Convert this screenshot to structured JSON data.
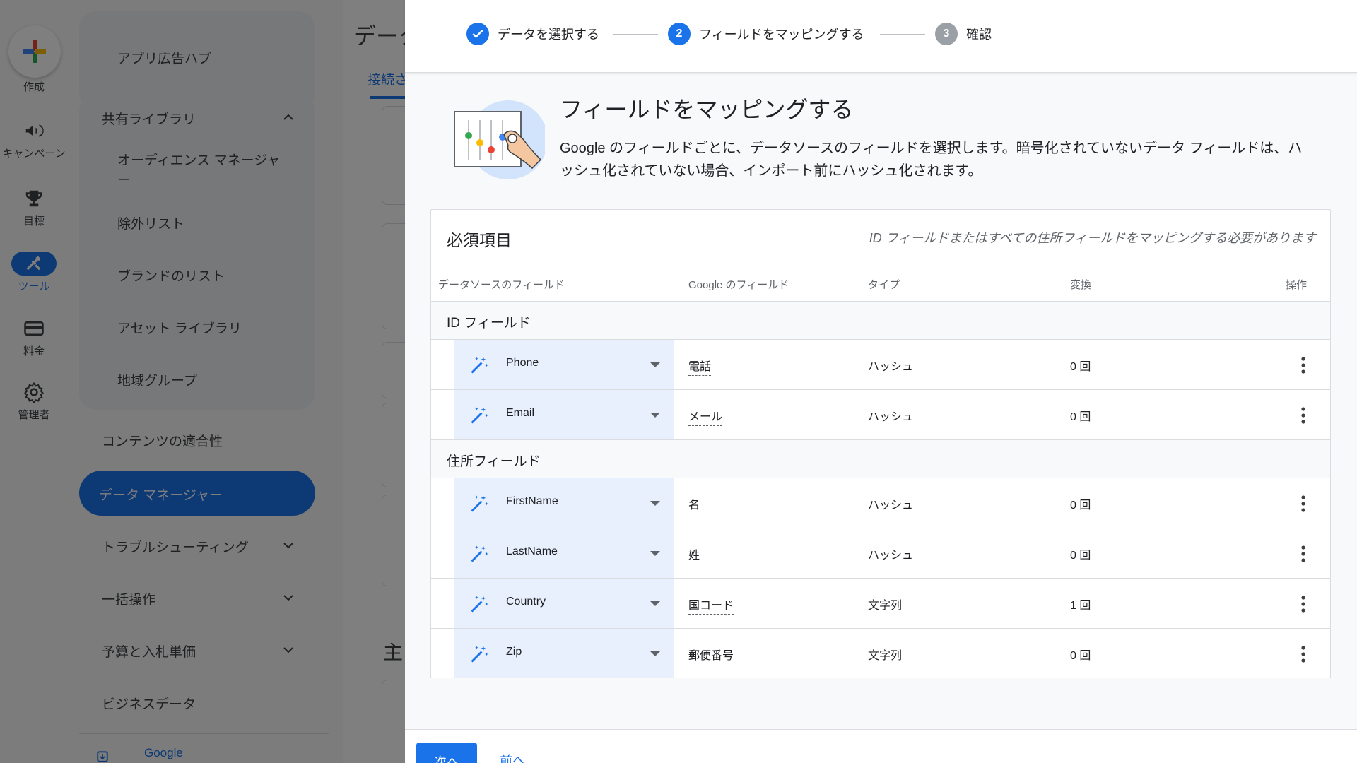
{
  "rail": {
    "items": [
      {
        "label": "作成"
      },
      {
        "label": "キャンペーン"
      },
      {
        "label": "目標"
      },
      {
        "label": "ツール"
      },
      {
        "label": "料金"
      },
      {
        "label": "管理者"
      }
    ]
  },
  "subnav": {
    "app_ads_hub": "アプリ広告ハブ",
    "shared_library": "共有ライブラリ",
    "shared_items": [
      "オーディエンス マネージャー",
      "除外リスト",
      "ブランドのリスト",
      "アセット ライブラリ",
      "地域グループ"
    ],
    "content_suitability": "コンテンツの適合性",
    "data_manager": "データ マネージャー",
    "troubleshooting": "トラブルシューティング",
    "bulk_actions": "一括操作",
    "budgets_bids": "予算と入札単価",
    "business_data": "ビジネスデータ",
    "google_link": "Google"
  },
  "background": {
    "title": "データ",
    "tab": "接続さ",
    "subheading": "主"
  },
  "stepper": {
    "steps": [
      {
        "number": "",
        "label": "データを選択する",
        "state": "done"
      },
      {
        "number": "2",
        "label": "フィールドをマッピングする",
        "state": "current"
      },
      {
        "number": "3",
        "label": "確認",
        "state": "upcoming"
      }
    ]
  },
  "hero": {
    "title": "フィールドをマッピングする",
    "description": "Google のフィールドごとに、データソースのフィールドを選択します。暗号化されていないデータ フィールドは、ハッシュ化されていない場合、インポート前にハッシュ化されます。"
  },
  "card": {
    "title": "必須項目",
    "note": "ID フィールドまたはすべての住所フィールドをマッピングする必要があります",
    "headers": {
      "source": "データソースのフィールド",
      "google": "Google のフィールド",
      "type": "タイプ",
      "transform": "変換",
      "actions": "操作"
    },
    "sections": [
      {
        "title": "ID フィールド",
        "rows": [
          {
            "source": "Phone",
            "google": "電話",
            "type": "ハッシュ",
            "transform": "0 回"
          },
          {
            "source": "Email",
            "google": "メール",
            "type": "ハッシュ",
            "transform": "0 回"
          }
        ]
      },
      {
        "title": "住所フィールド",
        "rows": [
          {
            "source": "FirstName",
            "google": "名",
            "type": "ハッシュ",
            "transform": "0 回"
          },
          {
            "source": "LastName",
            "google": "姓",
            "type": "ハッシュ",
            "transform": "0 回"
          },
          {
            "source": "Country",
            "google": "国コード",
            "type": "文字列",
            "transform": "1 回"
          },
          {
            "source": "Zip",
            "google": "郵便番号",
            "type": "文字列",
            "transform": "0 回"
          }
        ]
      }
    ]
  },
  "footer": {
    "next": "次へ",
    "prev": "前へ"
  },
  "colors": {
    "accent": "#1a73e8",
    "select_bg": "#e8f0fe",
    "step_upcoming": "#9aa0a6"
  }
}
